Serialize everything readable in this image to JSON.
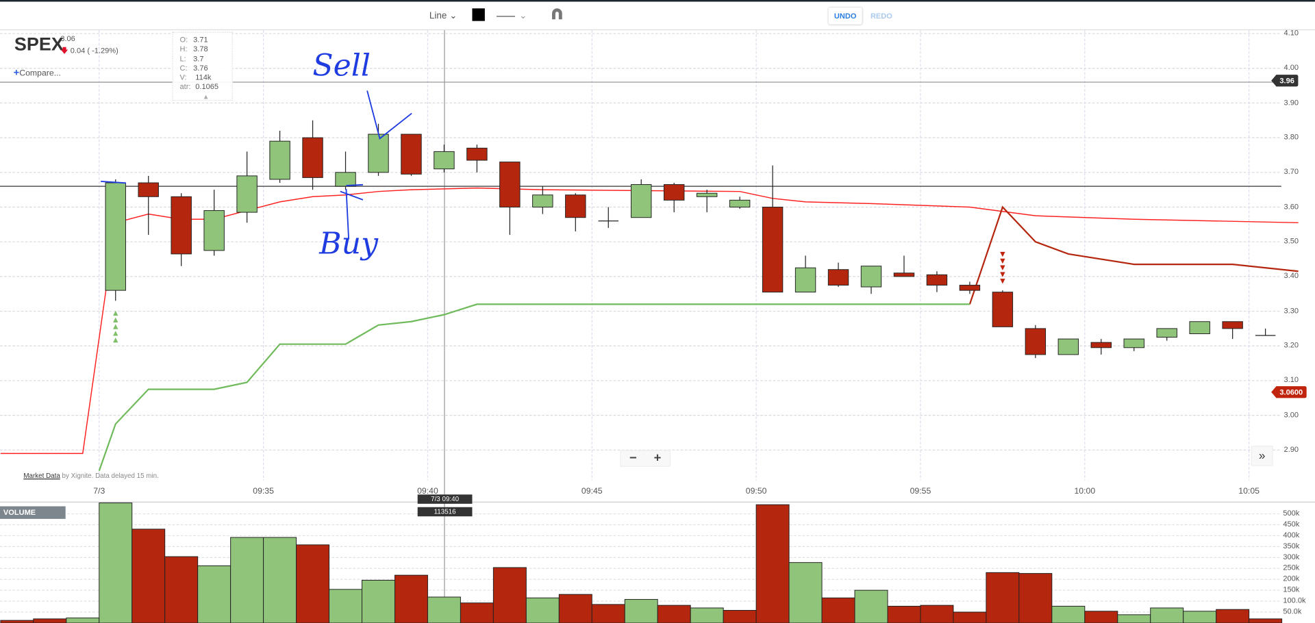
{
  "toolbar": {
    "chart_type": "Line ⌄",
    "line_style_chevron": "⌄",
    "undo": "UNDO",
    "redo": "REDO",
    "magnet": "magnet-icon"
  },
  "header": {
    "symbol": "SPEX",
    "last": "3.06",
    "change": "0.04 ( -1.29%)",
    "compare": "Compare..."
  },
  "ohlc": {
    "O": "3.71",
    "H": "3.78",
    "L": "3.7",
    "C": "3.76",
    "V": "114k",
    "atr": "0.1065"
  },
  "crosshair": {
    "time": "7/3 09:40",
    "volume": "113516"
  },
  "badges": {
    "line_value": "3.96",
    "last_price": "3.0600"
  },
  "credit": {
    "link": "Market Data",
    "text": " by Xignite. Data delayed 15 min."
  },
  "controls": {
    "zoom_out": "−",
    "zoom_in": "+",
    "scroll_end": "»"
  },
  "volume_label": "VOLUME",
  "annotations": {
    "sell": "Sell",
    "buy": "Buy"
  },
  "colors": {
    "up": "#8fc47a",
    "down": "#b5260f",
    "vwap": "#ff2020",
    "stop": "#b5260f",
    "trail": "#6fba5a",
    "upArrow": "#7fbf6a",
    "downArrow": "#c0240c"
  },
  "chart_data": {
    "type": "candlestick",
    "title": "SPEX",
    "x_start": "09:30",
    "x_tick_labels": [
      "7/3",
      "09:35",
      "09:40",
      "09:45",
      "09:50",
      "09:55",
      "10:00",
      "10:05"
    ],
    "y_tick_labels": [
      "4.10",
      "4.00",
      "3.90",
      "3.80",
      "3.70",
      "3.60",
      "3.50",
      "3.40",
      "3.30",
      "3.20",
      "3.10",
      "3.00",
      "2.90"
    ],
    "ylim": [
      2.82,
      4.1
    ],
    "candles": [
      [
        3.36,
        3.68,
        3.33,
        3.67
      ],
      [
        3.67,
        3.69,
        3.52,
        3.63
      ],
      [
        3.63,
        3.64,
        3.43,
        3.465
      ],
      [
        3.475,
        3.65,
        3.46,
        3.59
      ],
      [
        3.585,
        3.76,
        3.555,
        3.69
      ],
      [
        3.68,
        3.82,
        3.67,
        3.79
      ],
      [
        3.8,
        3.85,
        3.65,
        3.685
      ],
      [
        3.66,
        3.76,
        3.65,
        3.7
      ],
      [
        3.7,
        3.84,
        3.69,
        3.81
      ],
      [
        3.81,
        3.81,
        3.69,
        3.695
      ],
      [
        3.71,
        3.78,
        3.7,
        3.76
      ],
      [
        3.77,
        3.78,
        3.7,
        3.735
      ],
      [
        3.73,
        3.73,
        3.52,
        3.6
      ],
      [
        3.6,
        3.66,
        3.58,
        3.635
      ],
      [
        3.635,
        3.64,
        3.53,
        3.57
      ],
      [
        3.56,
        3.6,
        3.54,
        3.56
      ],
      [
        3.57,
        3.68,
        3.57,
        3.665
      ],
      [
        3.665,
        3.67,
        3.585,
        3.62
      ],
      [
        3.63,
        3.65,
        3.585,
        3.64
      ],
      [
        3.6,
        3.63,
        3.595,
        3.62
      ],
      [
        3.6,
        3.72,
        3.355,
        3.355
      ],
      [
        3.355,
        3.46,
        3.355,
        3.425
      ],
      [
        3.42,
        3.44,
        3.37,
        3.375
      ],
      [
        3.37,
        3.43,
        3.35,
        3.43
      ],
      [
        3.41,
        3.46,
        3.4,
        3.4
      ],
      [
        3.405,
        3.415,
        3.355,
        3.375
      ],
      [
        3.375,
        3.385,
        3.35,
        3.36
      ],
      [
        3.355,
        3.36,
        3.255,
        3.255
      ],
      [
        3.25,
        3.26,
        3.165,
        3.175
      ],
      [
        3.175,
        3.22,
        3.175,
        3.22
      ],
      [
        3.21,
        3.22,
        3.175,
        3.195
      ],
      [
        3.195,
        3.22,
        3.185,
        3.22
      ],
      [
        3.225,
        3.25,
        3.215,
        3.25
      ],
      [
        3.235,
        3.27,
        3.235,
        3.27
      ],
      [
        3.27,
        3.27,
        3.22,
        3.25
      ],
      [
        3.23,
        3.25,
        3.23,
        3.23
      ]
    ],
    "lines": {
      "vwap": [
        [
          -3,
          2.89
        ],
        [
          -0.5,
          2.89
        ],
        [
          0.5,
          3.555
        ],
        [
          1.5,
          3.58
        ],
        [
          2.5,
          3.565
        ],
        [
          3.5,
          3.565
        ],
        [
          4.5,
          3.59
        ],
        [
          5.5,
          3.615
        ],
        [
          6.5,
          3.63
        ],
        [
          7.5,
          3.635
        ],
        [
          8.5,
          3.645
        ],
        [
          9.5,
          3.65
        ],
        [
          11.5,
          3.655
        ],
        [
          13.5,
          3.65
        ],
        [
          19.5,
          3.645
        ],
        [
          20.5,
          3.625
        ],
        [
          21.5,
          3.615
        ],
        [
          23.5,
          3.61
        ],
        [
          26.5,
          3.6
        ],
        [
          28.5,
          3.575
        ],
        [
          31.5,
          3.565
        ],
        [
          36.5,
          3.555
        ]
      ],
      "trail_stop_short": [
        [
          26.5,
          3.32
        ],
        [
          27.5,
          3.6
        ],
        [
          28.5,
          3.5
        ],
        [
          29.5,
          3.465
        ],
        [
          31.5,
          3.435
        ],
        [
          34.5,
          3.435
        ],
        [
          36.5,
          3.415
        ]
      ],
      "trail_stop_long": [
        [
          0,
          2.84
        ],
        [
          0.5,
          2.975
        ],
        [
          1.5,
          3.075
        ],
        [
          3.5,
          3.075
        ],
        [
          4.5,
          3.095
        ],
        [
          5.5,
          3.205
        ],
        [
          7.5,
          3.205
        ],
        [
          8.5,
          3.26
        ],
        [
          9.5,
          3.27
        ],
        [
          10.5,
          3.29
        ],
        [
          11.5,
          3.32
        ],
        [
          26.5,
          3.32
        ]
      ]
    },
    "hlines": [
      3.66,
      3.96
    ],
    "signals": [
      {
        "type": "buy",
        "minute": 0
      },
      {
        "type": "sell",
        "minute": 27
      }
    ],
    "volume": {
      "y_tick_labels": [
        "500k",
        "450k",
        "400k",
        "350k",
        "300k",
        "250k",
        "200k",
        "150k",
        "100.0k",
        "50.0k"
      ],
      "start_minute": -3,
      "values_k": [
        12,
        19,
        23,
        550,
        430,
        304,
        262,
        392,
        392,
        358,
        154,
        196,
        219,
        119,
        92,
        254,
        115,
        131,
        85,
        108,
        81,
        69,
        58,
        542,
        277,
        115,
        150,
        77,
        81,
        50,
        231,
        227,
        77,
        54,
        38,
        69,
        54,
        62,
        19
      ],
      "up": [
        0,
        0,
        1,
        1,
        0,
        0,
        1,
        1,
        1,
        0,
        1,
        1,
        0,
        1,
        0,
        0,
        1,
        0,
        0,
        1,
        0,
        1,
        0,
        0,
        1,
        0,
        1,
        0,
        0,
        0,
        0,
        0,
        1,
        0,
        1,
        1,
        1,
        0,
        0
      ]
    }
  }
}
